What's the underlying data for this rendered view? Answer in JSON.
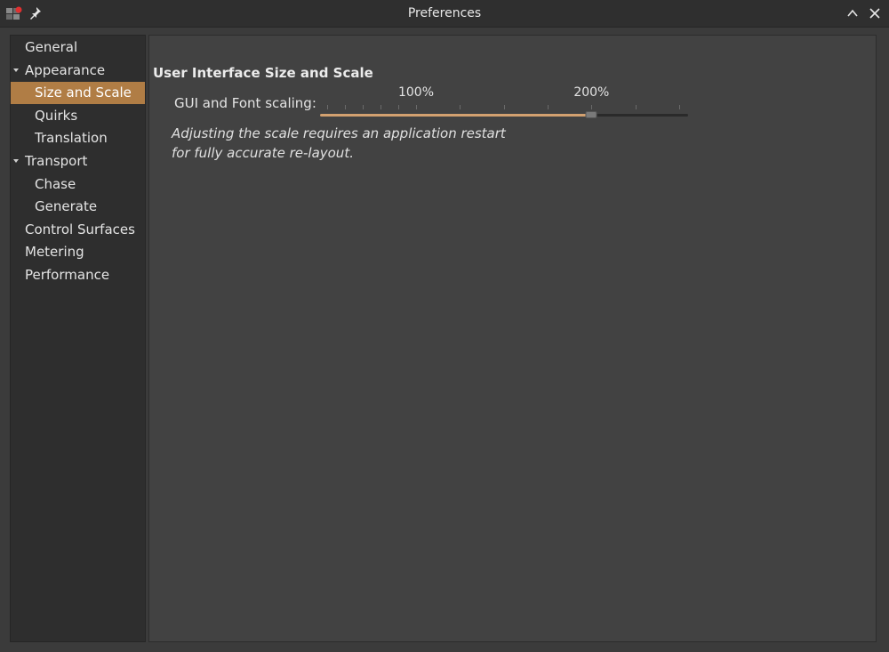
{
  "window": {
    "title": "Preferences"
  },
  "sidebar": {
    "items": [
      {
        "label": "General",
        "level": 0,
        "expander": false,
        "selected": false
      },
      {
        "label": "Appearance",
        "level": 0,
        "expander": true,
        "selected": false
      },
      {
        "label": "Size and Scale",
        "level": 1,
        "expander": false,
        "selected": true
      },
      {
        "label": "Quirks",
        "level": 1,
        "expander": false,
        "selected": false
      },
      {
        "label": "Translation",
        "level": 1,
        "expander": false,
        "selected": false
      },
      {
        "label": "Transport",
        "level": 0,
        "expander": true,
        "selected": false
      },
      {
        "label": "Chase",
        "level": 1,
        "expander": false,
        "selected": false
      },
      {
        "label": "Generate",
        "level": 1,
        "expander": false,
        "selected": false
      },
      {
        "label": "Control Surfaces",
        "level": 0,
        "expander": false,
        "selected": false
      },
      {
        "label": "Metering",
        "level": 0,
        "expander": false,
        "selected": false
      },
      {
        "label": "Performance",
        "level": 0,
        "expander": false,
        "selected": false
      }
    ]
  },
  "content": {
    "section_title": "User Interface Size and Scale",
    "scaling_label": "GUI and Font scaling:",
    "slider": {
      "min_percent": 50,
      "max_percent": 250,
      "value_percent": 200,
      "marks": [
        {
          "percent": 100,
          "label": "100%"
        },
        {
          "percent": 200,
          "label": "200%"
        }
      ],
      "ticks_percent": [
        50,
        60,
        70,
        80,
        90,
        100,
        125,
        150,
        175,
        200,
        225,
        250
      ]
    },
    "note_line1": "Adjusting the scale requires an application restart",
    "note_line2": "for fully accurate re-layout."
  },
  "colors": {
    "accent": "#b07d45",
    "slider_fill": "#d3a170",
    "background": "#3b3b3b"
  },
  "icons": {
    "app": "ardour-app-icon",
    "pin": "pin-icon",
    "collapse": "chevron-up-icon",
    "close": "close-icon"
  }
}
